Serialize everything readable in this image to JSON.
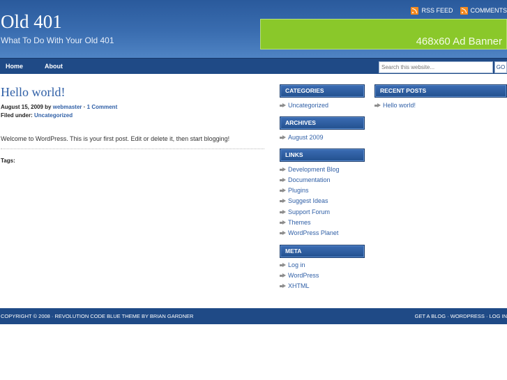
{
  "header": {
    "site_title": "Old 401",
    "tagline": "What To Do With Your Old 401",
    "rss_feed": "RSS FEED",
    "comments": "COMMENTS",
    "ad_banner": "468x60 Ad Banner"
  },
  "nav": {
    "items": [
      "Home",
      "About"
    ],
    "search_placeholder": "Search this website...",
    "go_label": "GO"
  },
  "post": {
    "title": "Hello world!",
    "date": "August 15, 2009",
    "by": "by",
    "author": "webmaster",
    "separator": "·",
    "comments": "1 Comment",
    "filed_label": "Filed under:",
    "category": "Uncategorized",
    "body": "Welcome to WordPress. This is your first post. Edit or delete it, then start blogging!",
    "tags_label": "Tags:"
  },
  "sidebar_left": {
    "categories_title": "CATEGORIES",
    "categories": [
      "Uncategorized"
    ],
    "archives_title": "ARCHIVES",
    "archives": [
      "August 2009"
    ],
    "links_title": "LINKS",
    "links": [
      "Development Blog",
      "Documentation",
      "Plugins",
      "Suggest Ideas",
      "Support Forum",
      "Themes",
      "WordPress Planet"
    ],
    "meta_title": "META",
    "meta": [
      "Log in",
      "WordPress",
      "XHTML"
    ]
  },
  "sidebar_right": {
    "recent_title": "RECENT POSTS",
    "recent": [
      "Hello world!"
    ]
  },
  "footer": {
    "left": "COPYRIGHT © 2008 · REVOLUTION CODE BLUE THEME BY BRIAN GARDNER",
    "right": "GET A BLOG · WORDPRESS · LOG IN"
  },
  "colors": {
    "header_blue": "#3a6db0",
    "nav_blue": "#1f4a86",
    "link_blue": "#2f5fa6",
    "ad_green": "#8ac82a",
    "rss_orange": "#f58a20"
  }
}
